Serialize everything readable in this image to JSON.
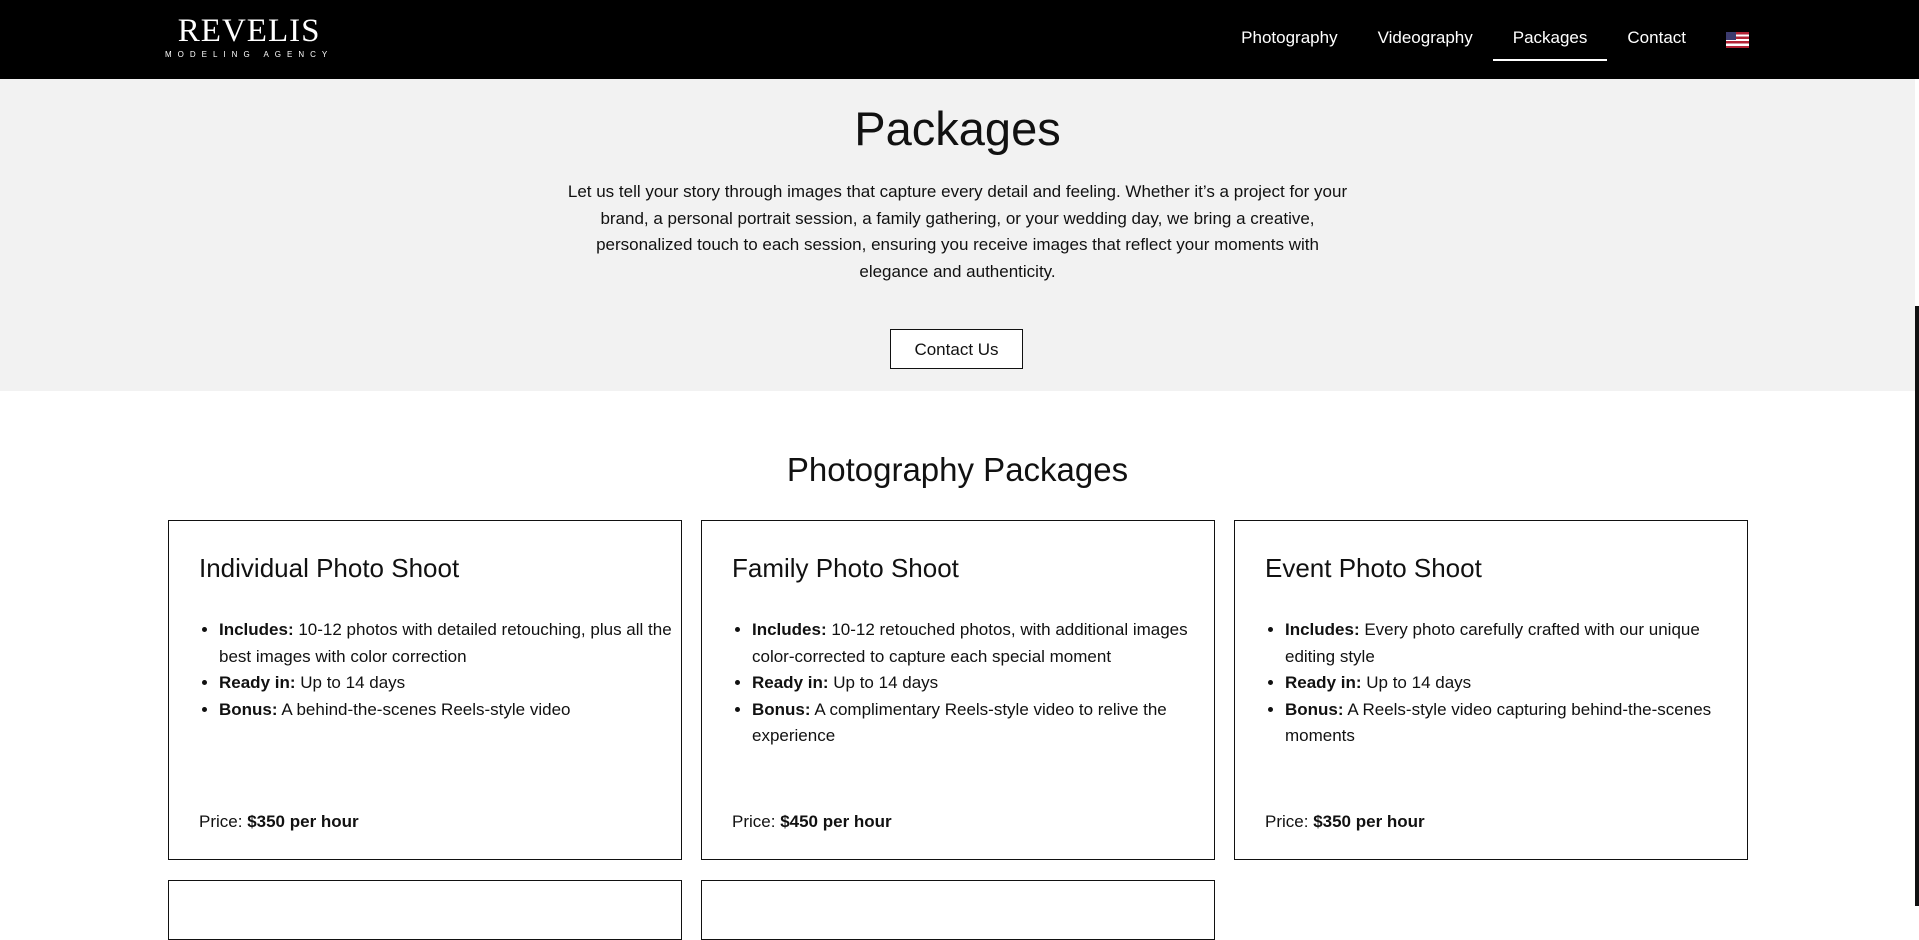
{
  "header": {
    "logo_main": "REVELIS",
    "logo_sub": "MODELING AGENCY",
    "nav": [
      {
        "label": "Photography",
        "active": false
      },
      {
        "label": "Videography",
        "active": false
      },
      {
        "label": "Packages",
        "active": true
      },
      {
        "label": "Contact",
        "active": false
      }
    ],
    "language_icon": "us-flag-icon"
  },
  "hero": {
    "title": "Packages",
    "text": "Let us tell your story through images that capture every detail and feeling. Whether it’s a project for your brand, a personal portrait session, a family gathering, or your wedding day, we bring a creative, personalized touch to each session, ensuring you receive images that reflect your moments with elegance and authenticity.",
    "button_label": "Contact Us"
  },
  "section": {
    "title": "Photography Packages",
    "cards": [
      {
        "title": "Individual Photo Shoot",
        "includes_label": "Includes:",
        "includes": " 10-12 photos with detailed retouching, plus all the best images with color correction",
        "ready_label": "Ready in:",
        "ready": " Up to 14 days",
        "bonus_label": "Bonus:",
        "bonus": " A behind-the-scenes Reels-style video",
        "price_label": "Price: ",
        "price": "$350 per hour"
      },
      {
        "title": "Family Photo Shoot",
        "includes_label": "Includes:",
        "includes": " 10-12 retouched photos, with additional images color-corrected to capture each special moment",
        "ready_label": "Ready in:",
        "ready": " Up to 14 days",
        "bonus_label": "Bonus:",
        "bonus": " A complimentary Reels-style video to relive the experience",
        "price_label": "Price: ",
        "price": "$450 per hour"
      },
      {
        "title": "Event Photo Shoot",
        "includes_label": "Includes:",
        "includes": " Every photo carefully crafted with our unique editing style",
        "ready_label": "Ready in:",
        "ready": " Up to 14 days",
        "bonus_label": "Bonus:",
        "bonus": " A Reels-style video capturing behind-the-scenes moments",
        "price_label": "Price: ",
        "price": "$350 per hour"
      }
    ]
  }
}
